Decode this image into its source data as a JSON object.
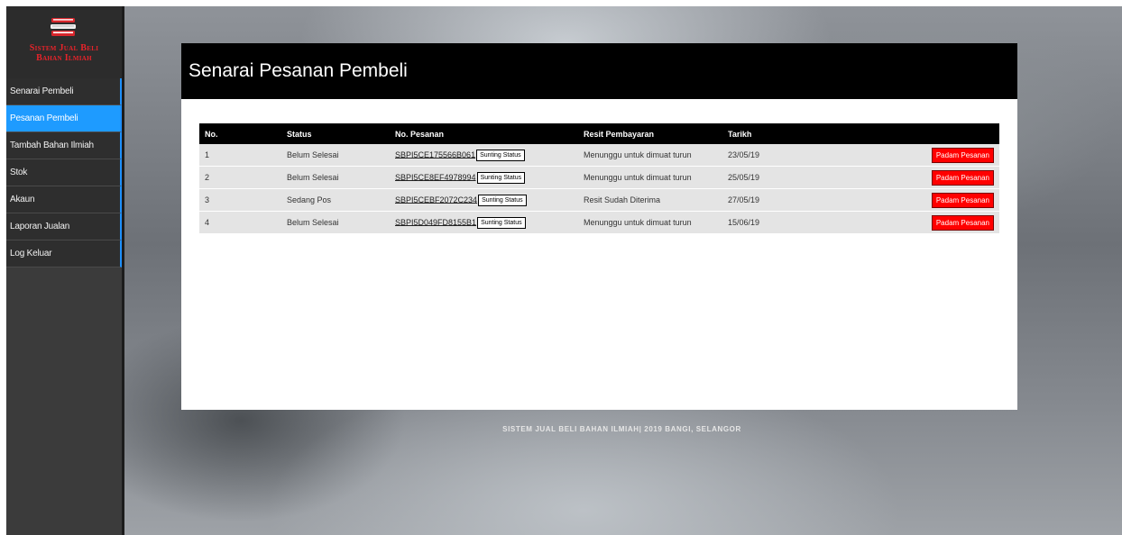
{
  "brand": {
    "line1": "Sistem Jual Beli",
    "line2": "Bahan Ilmiah",
    "icon": "books-stack-icon",
    "color": "#e8232a"
  },
  "sidebar": {
    "items": [
      {
        "label": "Senarai Pembeli"
      },
      {
        "label": "Pesanan Pembeli"
      },
      {
        "label": "Tambah Bahan Ilmiah"
      },
      {
        "label": "Stok"
      },
      {
        "label": "Akaun"
      },
      {
        "label": "Laporan Jualan"
      },
      {
        "label": "Log Keluar"
      }
    ],
    "active_color": "#1e9bff"
  },
  "page": {
    "title": "Senarai Pesanan Pembeli"
  },
  "table": {
    "headers": {
      "no": "No.",
      "status": "Status",
      "order_no": "No. Pesanan",
      "receipt": "Resit Pembayaran",
      "date": "Tarikh"
    },
    "edit_label": "Sunting Status",
    "delete_label": "Padam Pesanan",
    "rows": [
      {
        "no": "1",
        "status": "Belum Selesai",
        "order_no": "SBPI5CE175566B061",
        "receipt": "Menunggu untuk dimuat turun",
        "date": "23/05/19"
      },
      {
        "no": "2",
        "status": "Belum Selesai",
        "order_no": "SBPI5CE8EF4978994",
        "receipt": "Menunggu untuk dimuat turun",
        "date": "25/05/19"
      },
      {
        "no": "3",
        "status": "Sedang Pos",
        "order_no": "SBPI5CEBF2072C234",
        "receipt": "Resit Sudah Diterima",
        "date": "27/05/19"
      },
      {
        "no": "4",
        "status": "Belum Selesai",
        "order_no": "SBPI5D049FD8155B1",
        "receipt": "Menunggu untuk dimuat turun",
        "date": "15/06/19"
      }
    ]
  },
  "footer": {
    "text": "SISTEM JUAL BELI BAHAN ILMIAH| 2019 BANGI, SELANGOR"
  },
  "colors": {
    "danger": "#ff0000",
    "pending_text": "#e02424",
    "received_text": "#1a9e3a"
  }
}
